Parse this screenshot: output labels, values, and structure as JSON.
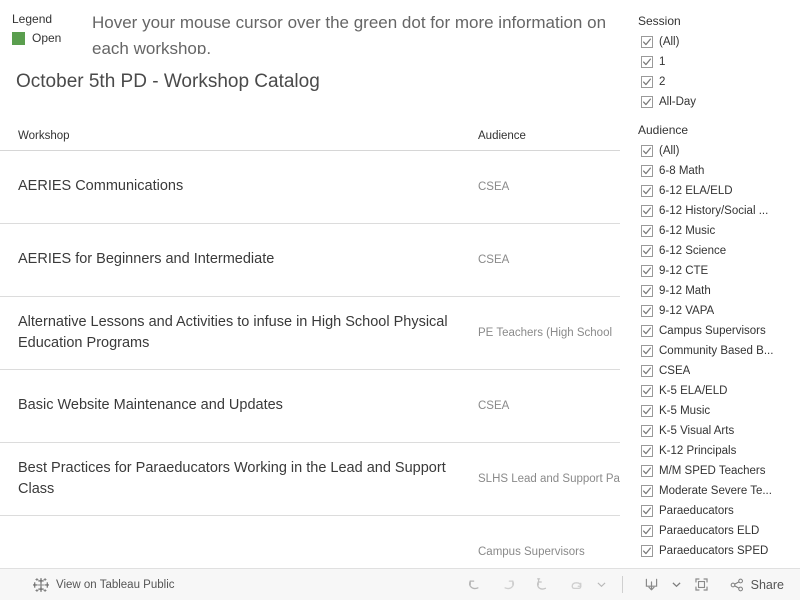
{
  "legend": {
    "title": "Legend",
    "items": [
      {
        "label": "Open",
        "color": "#5a9e4e"
      }
    ]
  },
  "header": {
    "note": "Hover your mouse cursor over the green dot for more information on each workshop."
  },
  "sheet": {
    "title": "October 5th PD - Workshop Catalog"
  },
  "table": {
    "columns": [
      "Workshop",
      "Audience"
    ],
    "rows": [
      {
        "workshop": "AERIES Communications",
        "audience": "CSEA"
      },
      {
        "workshop": "AERIES for Beginners and Intermediate",
        "audience": "CSEA"
      },
      {
        "workshop": "Alternative Lessons and Activities to infuse in High School Physical Education Programs",
        "audience": "PE Teachers (High School"
      },
      {
        "workshop": "Basic Website Maintenance and Updates",
        "audience": "CSEA"
      },
      {
        "workshop": "Best Practices for Paraeducators Working in the Lead and Support Class",
        "audience": "SLHS Lead and Support Paraeducators"
      },
      {
        "workshop": "",
        "audience": "Campus Supervisors"
      }
    ]
  },
  "filters": [
    {
      "title": "Session",
      "options": [
        {
          "label": "(All)",
          "checked": true
        },
        {
          "label": "1",
          "checked": true
        },
        {
          "label": "2",
          "checked": true
        },
        {
          "label": "All-Day",
          "checked": true
        }
      ]
    },
    {
      "title": "Audience",
      "options": [
        {
          "label": "(All)",
          "checked": true
        },
        {
          "label": "6-8 Math",
          "checked": true
        },
        {
          "label": "6-12 ELA/ELD",
          "checked": true
        },
        {
          "label": "6-12 History/Social ...",
          "checked": true
        },
        {
          "label": "6-12 Music",
          "checked": true
        },
        {
          "label": "6-12 Science",
          "checked": true
        },
        {
          "label": "9-12 CTE",
          "checked": true
        },
        {
          "label": "9-12 Math",
          "checked": true
        },
        {
          "label": "9-12 VAPA",
          "checked": true
        },
        {
          "label": "Campus Supervisors",
          "checked": true
        },
        {
          "label": "Community Based B...",
          "checked": true
        },
        {
          "label": "CSEA",
          "checked": true
        },
        {
          "label": "K-5 ELA/ELD",
          "checked": true
        },
        {
          "label": "K-5 Music",
          "checked": true
        },
        {
          "label": "K-5 Visual Arts",
          "checked": true
        },
        {
          "label": "K-12 Principals",
          "checked": true
        },
        {
          "label": "M/M SPED Teachers",
          "checked": true
        },
        {
          "label": "Moderate Severe Te...",
          "checked": true
        },
        {
          "label": "Paraeducators",
          "checked": true
        },
        {
          "label": "Paraeducators ELD",
          "checked": true
        },
        {
          "label": "Paraeducators SPED",
          "checked": true
        }
      ]
    }
  ],
  "toolbar": {
    "view_on_tableau_label": "View on Tableau Public",
    "share_label": "Share",
    "buttons": [
      "undo-icon",
      "redo-icon",
      "revert-icon",
      "refresh-icon",
      "download-icon",
      "fullscreen-icon",
      "share-icon"
    ]
  }
}
